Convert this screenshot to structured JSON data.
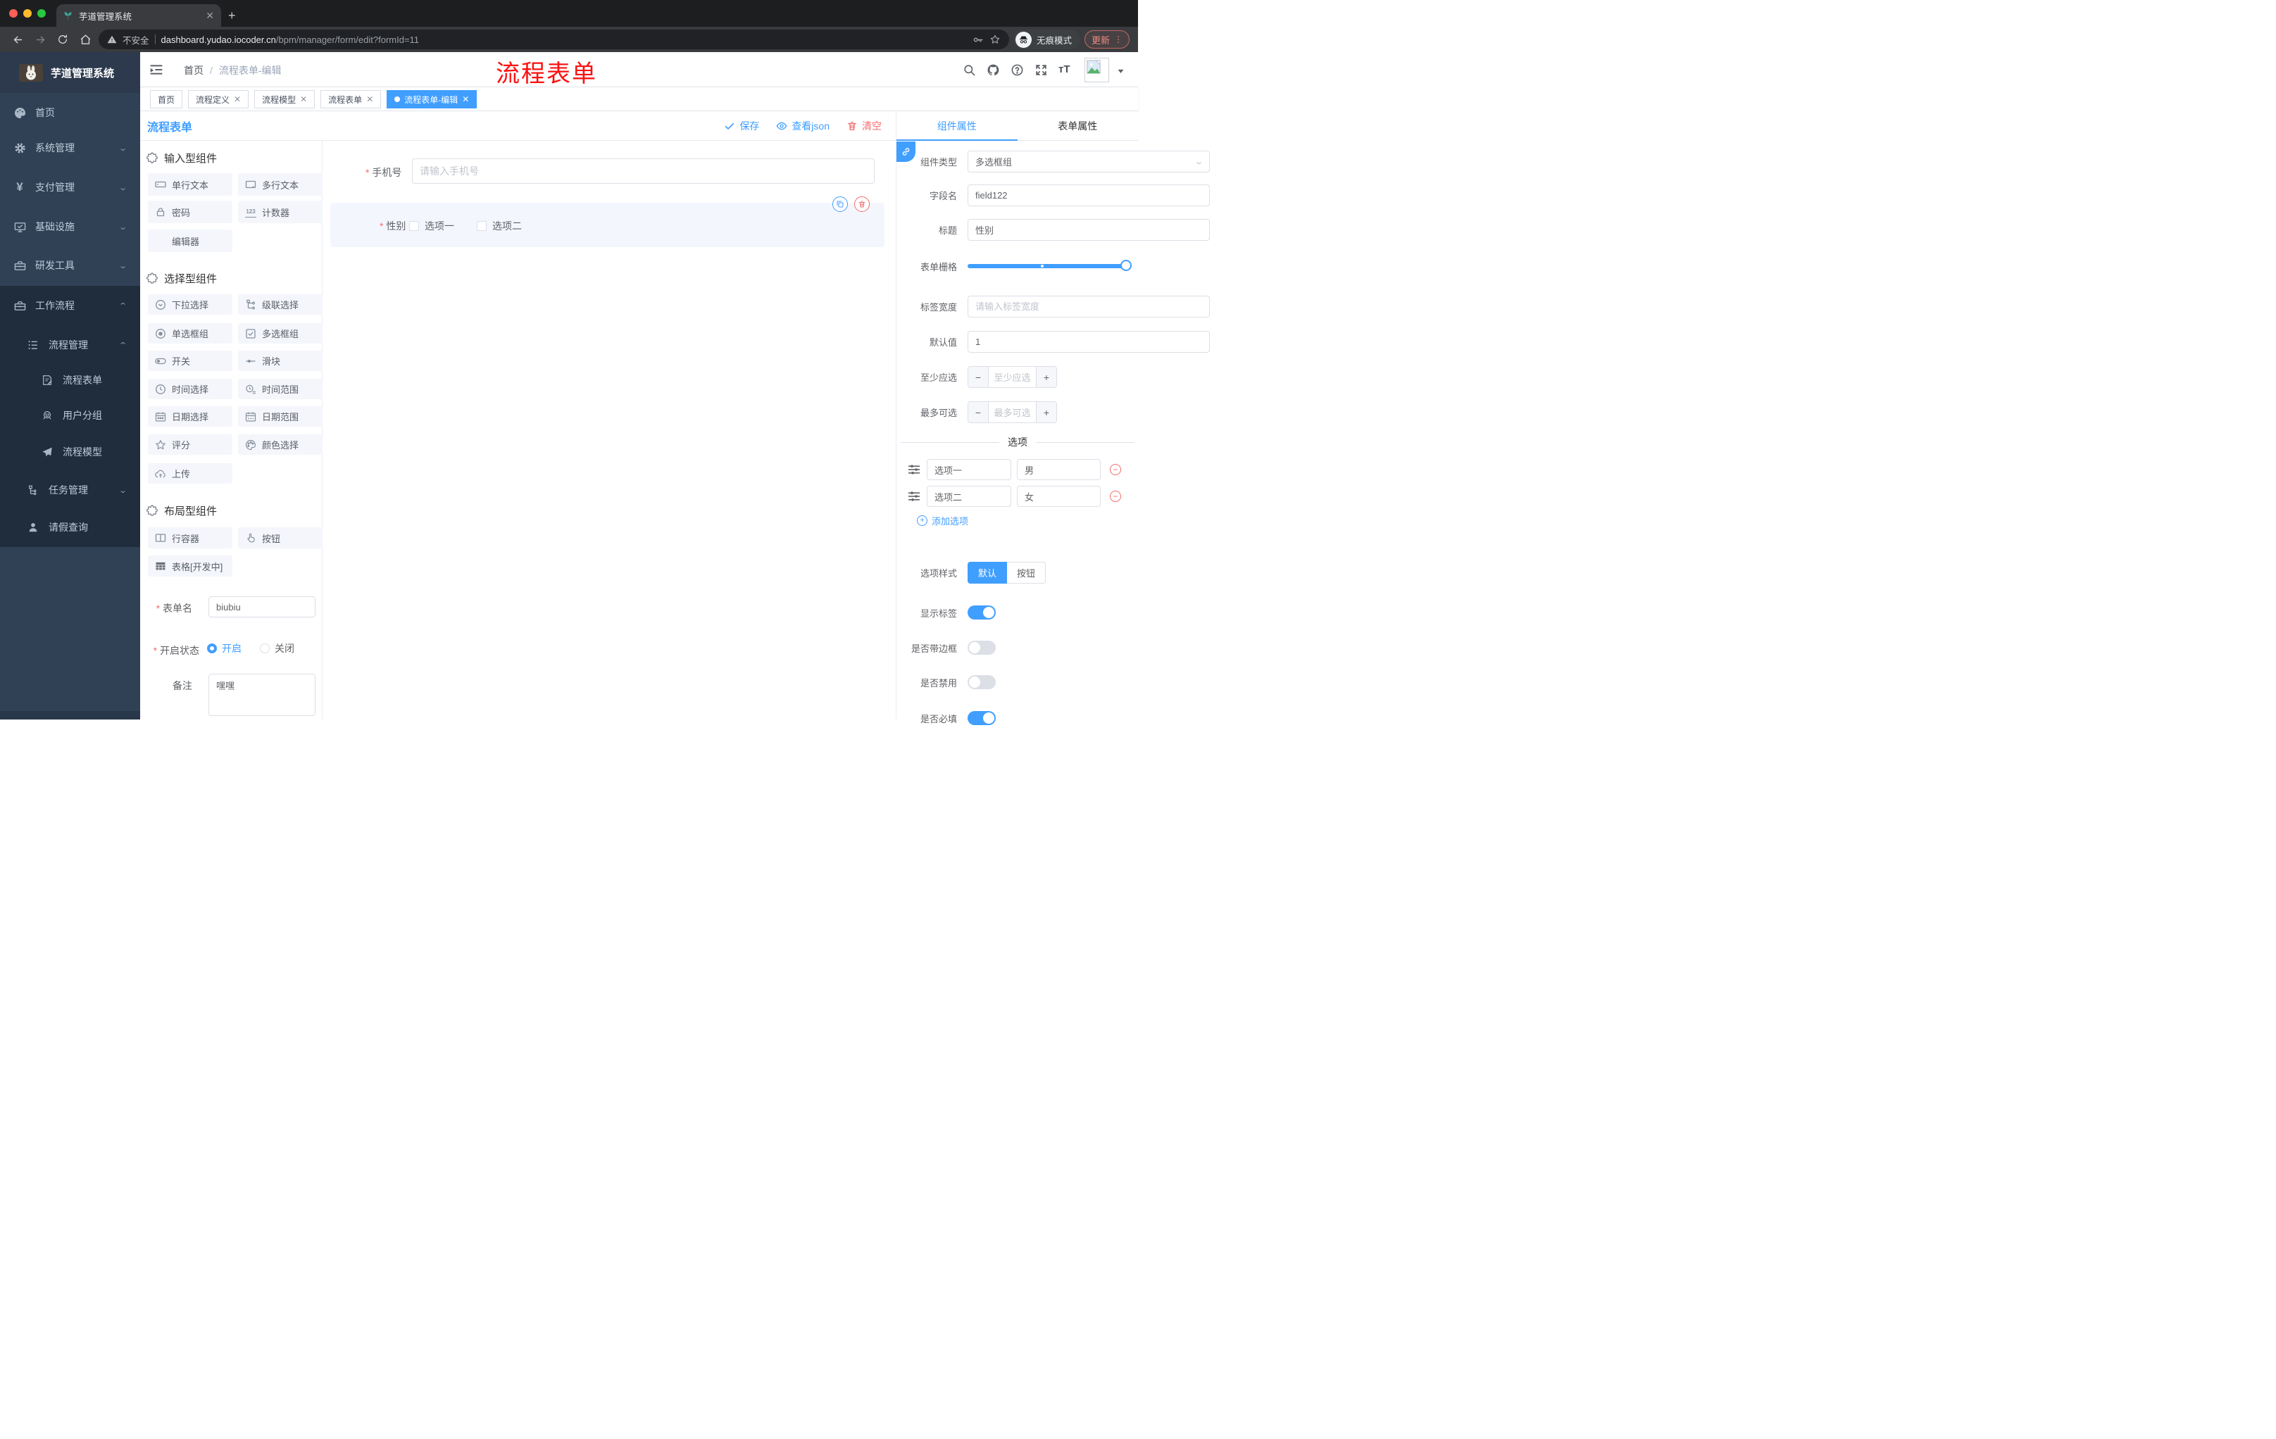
{
  "browser": {
    "tab_title": "芋道管理系统",
    "security_label": "不安全",
    "url_host": "dashboard.yudao.iocoder.cn",
    "url_path": "/bpm/manager/form/edit?formId=11",
    "incognito_label": "无痕模式",
    "update_label": "更新"
  },
  "annotation": {
    "text": "流程表单",
    "color": "#fb1010"
  },
  "sidebar": {
    "logo_title": "芋道管理系统",
    "menu": [
      {
        "label": "首页"
      },
      {
        "label": "系统管理"
      },
      {
        "label": "支付管理"
      },
      {
        "label": "基础设施"
      },
      {
        "label": "研发工具"
      },
      {
        "label": "工作流程"
      },
      {
        "label": "流程管理"
      },
      {
        "label": "流程表单"
      },
      {
        "label": "用户分组"
      },
      {
        "label": "流程模型"
      },
      {
        "label": "任务管理"
      },
      {
        "label": "请假查询"
      }
    ]
  },
  "navbar": {
    "breadcrumb_home": "首页",
    "breadcrumb_current": "流程表单-编辑"
  },
  "tags": [
    {
      "label": "首页"
    },
    {
      "label": "流程定义"
    },
    {
      "label": "流程模型"
    },
    {
      "label": "流程表单"
    },
    {
      "label": "流程表单-编辑"
    }
  ],
  "designer": {
    "title": "流程表单",
    "save_label": "保存",
    "view_json_label": "查看json",
    "clear_label": "清空",
    "sections": [
      {
        "title": "输入型组件",
        "items": [
          "单行文本",
          "多行文本",
          "密码",
          "计数器",
          "编辑器"
        ]
      },
      {
        "title": "选择型组件",
        "items": [
          "下拉选择",
          "级联选择",
          "单选框组",
          "多选框组",
          "开关",
          "滑块",
          "时间选择",
          "时间范围",
          "日期选择",
          "日期范围",
          "评分",
          "颜色选择",
          "上传"
        ]
      },
      {
        "title": "布局型组件",
        "items": [
          "行容器",
          "按钮",
          "表格[开发中]"
        ]
      }
    ],
    "meta_form": {
      "name_label": "表单名",
      "name_value": "biubiu",
      "status_label": "开启状态",
      "status_on": "开启",
      "status_off": "关闭",
      "remark_label": "备注",
      "remark_value": "嘿嘿"
    },
    "canvas": {
      "phone_label": "手机号",
      "phone_placeholder": "请输入手机号",
      "gender_label": "性别",
      "gender_option1": "选项一",
      "gender_option2": "选项二"
    }
  },
  "props_panel": {
    "tab_component": "组件属性",
    "tab_form": "表单属性",
    "component_type_label": "组件类型",
    "component_type_value": "多选框组",
    "field_name_label": "字段名",
    "field_name_value": "field122",
    "title_label": "标题",
    "title_value": "性别",
    "grid_label": "表单栅格",
    "label_width_label": "标签宽度",
    "label_width_placeholder": "请输入标签宽度",
    "default_label": "默认值",
    "default_value": "1",
    "min_label": "至少应选",
    "min_placeholder": "至少应选",
    "max_label": "最多可选",
    "max_placeholder": "最多可选",
    "options_title": "选项",
    "options": [
      {
        "name": "选项一",
        "value": "男"
      },
      {
        "name": "选项二",
        "value": "女"
      }
    ],
    "add_option_label": "添加选项",
    "style_label": "选项样式",
    "style_default": "默认",
    "style_button": "按钮",
    "switch_show_label": "显示标签",
    "switch_border": "是否带边框",
    "switch_disabled": "是否禁用",
    "switch_required": "是否必填"
  },
  "colors": {
    "accent": "#409eff",
    "danger": "#f56c6c",
    "sidebar_bg": "#304156",
    "submenu_bg": "#1f2d3d"
  }
}
